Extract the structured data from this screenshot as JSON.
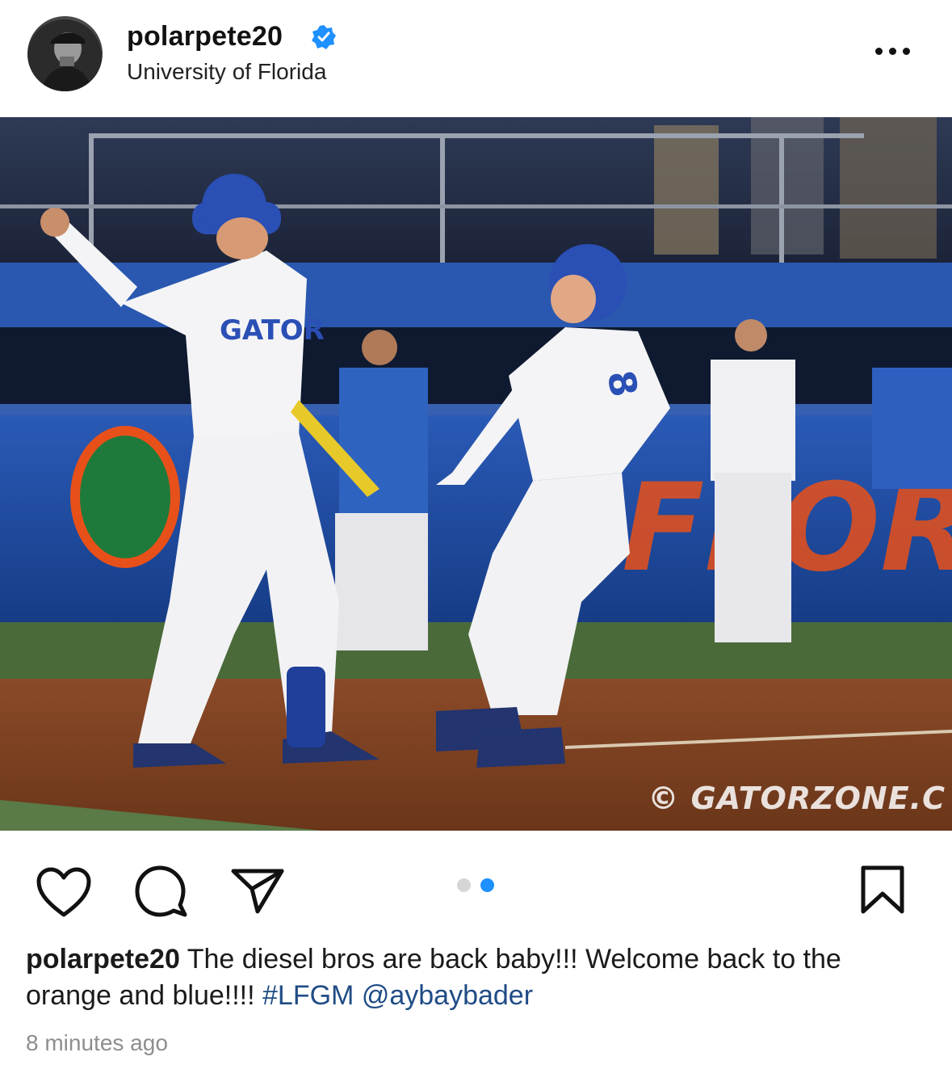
{
  "post": {
    "username": "polarpete20",
    "verified": true,
    "location": "University of Florida",
    "more_icon": "more-horizontal-icon",
    "photo": {
      "alt": "Two Florida Gators baseball players celebrating at home plate",
      "jersey_text": "GATOR",
      "jersey_number": "8",
      "banner_text": "FLORIDA",
      "watermark": "© GATORZONE.C"
    },
    "carousel": {
      "count": 2,
      "active_index": 1
    },
    "actions": {
      "like_icon": "heart-icon",
      "comment_icon": "comment-icon",
      "share_icon": "paper-plane-icon",
      "save_icon": "bookmark-icon"
    },
    "caption": {
      "user": "polarpete20",
      "text": " The diesel bros are back baby!!! Welcome back to the orange and blue!!!! ",
      "hashtag": "#LFGM",
      "mention": "@aybaybader"
    },
    "timestamp": "8 minutes ago"
  },
  "colors": {
    "verified_blue": "#1e90ff",
    "gator_blue": "#1f4ea8",
    "gator_orange": "#e8501a",
    "tag_blue": "#1f4c85"
  }
}
